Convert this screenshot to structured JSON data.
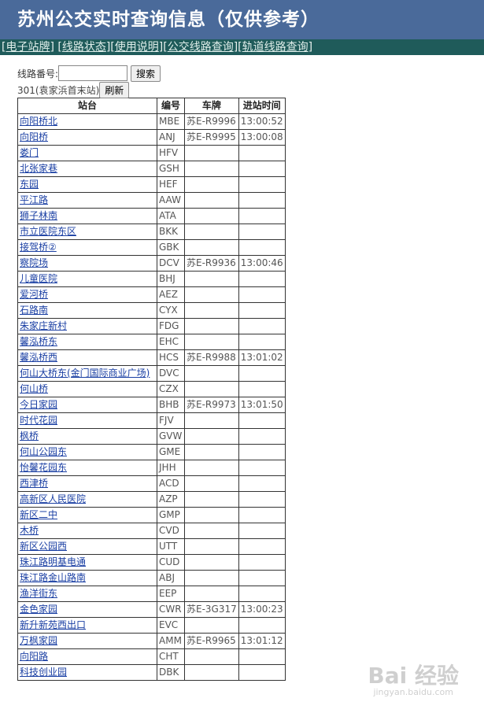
{
  "header": {
    "title": "苏州公交实时查询信息（仅供参考）"
  },
  "nav": {
    "items": [
      "电子站牌",
      "线路状态",
      "使用说明",
      "公交线路查询",
      "轨道线路查询"
    ]
  },
  "search": {
    "label": "线路番号:",
    "value": "",
    "button": "搜索"
  },
  "route": {
    "text": "301(袁家浜首末站)",
    "refresh": "刷新"
  },
  "table": {
    "headers": [
      "站台",
      "编号",
      "车牌",
      "进站时间"
    ],
    "rows": [
      {
        "name": "向阳桥北",
        "code": "MBE",
        "plate": "苏E-R9996",
        "time": "13:00:52"
      },
      {
        "name": "向阳桥",
        "code": "ANJ",
        "plate": "苏E-R9995",
        "time": "13:00:08"
      },
      {
        "name": "娄门",
        "code": "HFV",
        "plate": "",
        "time": ""
      },
      {
        "name": "北张家巷",
        "code": "GSH",
        "plate": "",
        "time": ""
      },
      {
        "name": "东园",
        "code": "HEF",
        "plate": "",
        "time": ""
      },
      {
        "name": "平江路",
        "code": "AAW",
        "plate": "",
        "time": ""
      },
      {
        "name": "狮子林南",
        "code": "ATA",
        "plate": "",
        "time": ""
      },
      {
        "name": "市立医院东区",
        "code": "BKK",
        "plate": "",
        "time": ""
      },
      {
        "name": "接驾桥②",
        "code": "GBK",
        "plate": "",
        "time": ""
      },
      {
        "name": "察院场",
        "code": "DCV",
        "plate": "苏E-R9936",
        "time": "13:00:46"
      },
      {
        "name": "儿童医院",
        "code": "BHJ",
        "plate": "",
        "time": ""
      },
      {
        "name": "爱河桥",
        "code": "AEZ",
        "plate": "",
        "time": ""
      },
      {
        "name": "石路南",
        "code": "CYX",
        "plate": "",
        "time": ""
      },
      {
        "name": "朱家庄新村",
        "code": "FDG",
        "plate": "",
        "time": ""
      },
      {
        "name": "馨泓桥东",
        "code": "EHC",
        "plate": "",
        "time": ""
      },
      {
        "name": "馨泓桥西",
        "code": "HCS",
        "plate": "苏E-R9988",
        "time": "13:01:02"
      },
      {
        "name": "何山大桥东(金门国际商业广场)",
        "code": "DVC",
        "plate": "",
        "time": ""
      },
      {
        "name": "何山桥",
        "code": "CZX",
        "plate": "",
        "time": ""
      },
      {
        "name": "今日家园",
        "code": "BHB",
        "plate": "苏E-R9973",
        "time": "13:01:50"
      },
      {
        "name": "时代花园",
        "code": "FJV",
        "plate": "",
        "time": ""
      },
      {
        "name": "枫桥",
        "code": "GVW",
        "plate": "",
        "time": ""
      },
      {
        "name": "何山公园东",
        "code": "GME",
        "plate": "",
        "time": ""
      },
      {
        "name": "怡馨花园东",
        "code": "JHH",
        "plate": "",
        "time": ""
      },
      {
        "name": "西津桥",
        "code": "ACD",
        "plate": "",
        "time": ""
      },
      {
        "name": "高新区人民医院",
        "code": "AZP",
        "plate": "",
        "time": ""
      },
      {
        "name": "新区二中",
        "code": "GMP",
        "plate": "",
        "time": ""
      },
      {
        "name": "木桥",
        "code": "CVD",
        "plate": "",
        "time": ""
      },
      {
        "name": "新区公园西",
        "code": "UTT",
        "plate": "",
        "time": ""
      },
      {
        "name": "珠江路明基电通",
        "code": "CUD",
        "plate": "",
        "time": ""
      },
      {
        "name": "珠江路金山路南",
        "code": "ABJ",
        "plate": "",
        "time": ""
      },
      {
        "name": "渔洋街东",
        "code": "EEP",
        "plate": "",
        "time": ""
      },
      {
        "name": "金色家园",
        "code": "CWR",
        "plate": "苏E-3G317",
        "time": "13:00:23"
      },
      {
        "name": "新升新苑西出口",
        "code": "EVC",
        "plate": "",
        "time": ""
      },
      {
        "name": "万枫家园",
        "code": "AMM",
        "plate": "苏E-R9965",
        "time": "13:01:12"
      },
      {
        "name": "向阳路",
        "code": "CHT",
        "plate": "",
        "time": ""
      },
      {
        "name": "科技创业园",
        "code": "DBK",
        "plate": "",
        "time": ""
      }
    ]
  },
  "watermark": {
    "text": "Bai 经验",
    "sub": "jingyan.baidu.com"
  }
}
